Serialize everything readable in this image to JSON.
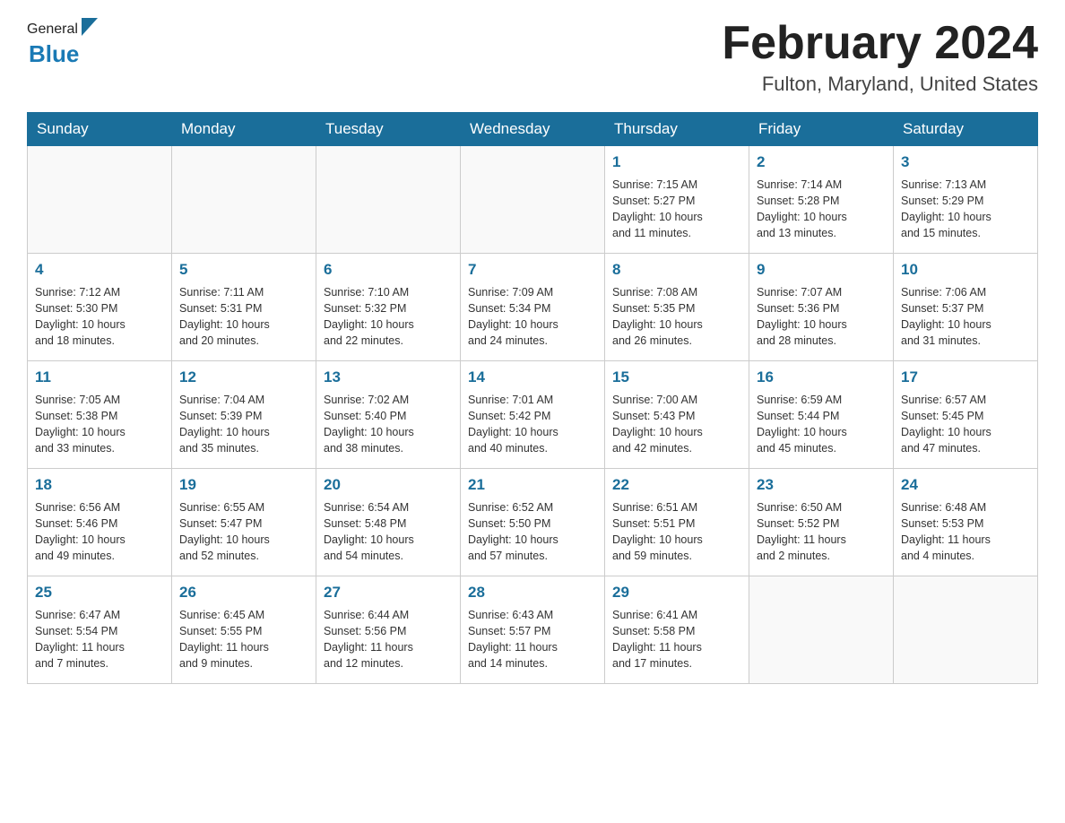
{
  "header": {
    "logo": {
      "general": "General",
      "blue": "Blue"
    },
    "title": "February 2024",
    "location": "Fulton, Maryland, United States"
  },
  "weekdays": [
    "Sunday",
    "Monday",
    "Tuesday",
    "Wednesday",
    "Thursday",
    "Friday",
    "Saturday"
  ],
  "weeks": [
    [
      {
        "day": "",
        "info": ""
      },
      {
        "day": "",
        "info": ""
      },
      {
        "day": "",
        "info": ""
      },
      {
        "day": "",
        "info": ""
      },
      {
        "day": "1",
        "info": "Sunrise: 7:15 AM\nSunset: 5:27 PM\nDaylight: 10 hours\nand 11 minutes."
      },
      {
        "day": "2",
        "info": "Sunrise: 7:14 AM\nSunset: 5:28 PM\nDaylight: 10 hours\nand 13 minutes."
      },
      {
        "day": "3",
        "info": "Sunrise: 7:13 AM\nSunset: 5:29 PM\nDaylight: 10 hours\nand 15 minutes."
      }
    ],
    [
      {
        "day": "4",
        "info": "Sunrise: 7:12 AM\nSunset: 5:30 PM\nDaylight: 10 hours\nand 18 minutes."
      },
      {
        "day": "5",
        "info": "Sunrise: 7:11 AM\nSunset: 5:31 PM\nDaylight: 10 hours\nand 20 minutes."
      },
      {
        "day": "6",
        "info": "Sunrise: 7:10 AM\nSunset: 5:32 PM\nDaylight: 10 hours\nand 22 minutes."
      },
      {
        "day": "7",
        "info": "Sunrise: 7:09 AM\nSunset: 5:34 PM\nDaylight: 10 hours\nand 24 minutes."
      },
      {
        "day": "8",
        "info": "Sunrise: 7:08 AM\nSunset: 5:35 PM\nDaylight: 10 hours\nand 26 minutes."
      },
      {
        "day": "9",
        "info": "Sunrise: 7:07 AM\nSunset: 5:36 PM\nDaylight: 10 hours\nand 28 minutes."
      },
      {
        "day": "10",
        "info": "Sunrise: 7:06 AM\nSunset: 5:37 PM\nDaylight: 10 hours\nand 31 minutes."
      }
    ],
    [
      {
        "day": "11",
        "info": "Sunrise: 7:05 AM\nSunset: 5:38 PM\nDaylight: 10 hours\nand 33 minutes."
      },
      {
        "day": "12",
        "info": "Sunrise: 7:04 AM\nSunset: 5:39 PM\nDaylight: 10 hours\nand 35 minutes."
      },
      {
        "day": "13",
        "info": "Sunrise: 7:02 AM\nSunset: 5:40 PM\nDaylight: 10 hours\nand 38 minutes."
      },
      {
        "day": "14",
        "info": "Sunrise: 7:01 AM\nSunset: 5:42 PM\nDaylight: 10 hours\nand 40 minutes."
      },
      {
        "day": "15",
        "info": "Sunrise: 7:00 AM\nSunset: 5:43 PM\nDaylight: 10 hours\nand 42 minutes."
      },
      {
        "day": "16",
        "info": "Sunrise: 6:59 AM\nSunset: 5:44 PM\nDaylight: 10 hours\nand 45 minutes."
      },
      {
        "day": "17",
        "info": "Sunrise: 6:57 AM\nSunset: 5:45 PM\nDaylight: 10 hours\nand 47 minutes."
      }
    ],
    [
      {
        "day": "18",
        "info": "Sunrise: 6:56 AM\nSunset: 5:46 PM\nDaylight: 10 hours\nand 49 minutes."
      },
      {
        "day": "19",
        "info": "Sunrise: 6:55 AM\nSunset: 5:47 PM\nDaylight: 10 hours\nand 52 minutes."
      },
      {
        "day": "20",
        "info": "Sunrise: 6:54 AM\nSunset: 5:48 PM\nDaylight: 10 hours\nand 54 minutes."
      },
      {
        "day": "21",
        "info": "Sunrise: 6:52 AM\nSunset: 5:50 PM\nDaylight: 10 hours\nand 57 minutes."
      },
      {
        "day": "22",
        "info": "Sunrise: 6:51 AM\nSunset: 5:51 PM\nDaylight: 10 hours\nand 59 minutes."
      },
      {
        "day": "23",
        "info": "Sunrise: 6:50 AM\nSunset: 5:52 PM\nDaylight: 11 hours\nand 2 minutes."
      },
      {
        "day": "24",
        "info": "Sunrise: 6:48 AM\nSunset: 5:53 PM\nDaylight: 11 hours\nand 4 minutes."
      }
    ],
    [
      {
        "day": "25",
        "info": "Sunrise: 6:47 AM\nSunset: 5:54 PM\nDaylight: 11 hours\nand 7 minutes."
      },
      {
        "day": "26",
        "info": "Sunrise: 6:45 AM\nSunset: 5:55 PM\nDaylight: 11 hours\nand 9 minutes."
      },
      {
        "day": "27",
        "info": "Sunrise: 6:44 AM\nSunset: 5:56 PM\nDaylight: 11 hours\nand 12 minutes."
      },
      {
        "day": "28",
        "info": "Sunrise: 6:43 AM\nSunset: 5:57 PM\nDaylight: 11 hours\nand 14 minutes."
      },
      {
        "day": "29",
        "info": "Sunrise: 6:41 AM\nSunset: 5:58 PM\nDaylight: 11 hours\nand 17 minutes."
      },
      {
        "day": "",
        "info": ""
      },
      {
        "day": "",
        "info": ""
      }
    ]
  ]
}
